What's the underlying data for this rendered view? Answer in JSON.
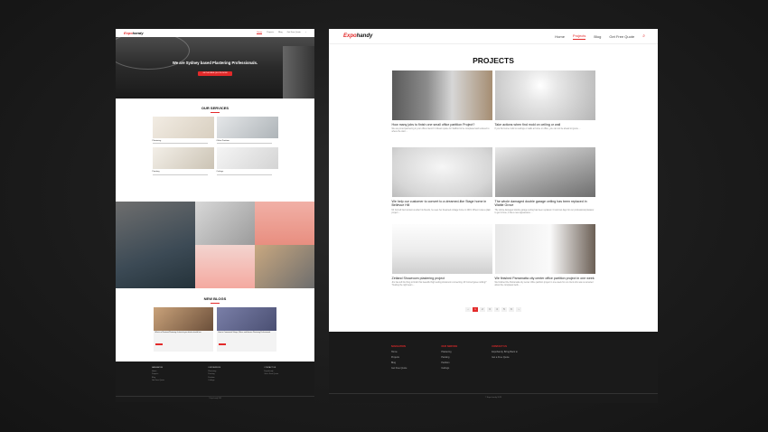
{
  "left": {
    "logo": {
      "mark": "Expo",
      "text": "handy"
    },
    "nav": [
      "Home",
      "Projects",
      "Blog",
      "Get Free Quote"
    ],
    "hero": {
      "title": "We are Sydney based Plastering Professionals.",
      "button": "GET A FREE QUOTE NOW"
    },
    "services": {
      "title": "OUR SERVICES",
      "items": [
        {
          "name": "Plastering"
        },
        {
          "name": "Office Partition"
        },
        {
          "name": "Painting"
        },
        {
          "name": "Ceilings"
        }
      ]
    },
    "blogs": {
      "title": "NEW BLOGS",
      "items": [
        {
          "caption": "What is a Plasterer/Plastering & what do you do/who should hire"
        },
        {
          "caption": "How to Commercial Shops, Offices and Houses Plastering Professionals"
        }
      ]
    },
    "footer": {
      "cols": [
        {
          "head": "NAVIGATION",
          "items": [
            "Home",
            "Projects",
            "Blog",
            "Get Free Quote"
          ]
        },
        {
          "head": "OUR SERVICE",
          "items": [
            "Plastering",
            "Painting",
            "Partition",
            "Ceilings"
          ]
        },
        {
          "head": "CONTACT US",
          "items": [
            "Expohandy",
            "Get a Free Quote"
          ]
        }
      ],
      "copy": "© Expo handy 2023"
    }
  },
  "right": {
    "logo": {
      "mark": "Expo",
      "text": "handy"
    },
    "nav": [
      "Home",
      "Projects",
      "Blog",
      "Get Free Quote"
    ],
    "nav_active": "Projects",
    "title": "PROJECTS",
    "cards": [
      {
        "title": "How many jobs to finish one small office partition Project?",
        "excerpt": "We are proud partnering in your office interior! A Dream space for Stafford to be completed and reduced to where the start ..."
      },
      {
        "title": "Take actions when find mold on ceiling or wall",
        "excerpt": "If you find some mold on ceilings or walls at home or office, you can not be ahead to ignore ..."
      },
      {
        "title": "We help our customer to convert to a dreamed-like Stage home in Bellevue Hill",
        "excerpt": "Mr Cornell had contact us after his friends, he sees her dreamed cottage home in 2019. When it was a plain project ..."
      },
      {
        "title": "The whole damaged double garage ceiling has been replaced in Wattle Grove",
        "excerpt": "The whole damaged double garage ceiling has been replaced. It took two days for our professional plasterer to get it done, it has a new appearance ..."
      },
      {
        "title": "Zetland Showroom plastering project",
        "excerpt": "Jim has left his thing to finish this beautiful high ceiling showroom connecting. Mr Cornell gave nothing? Trusting the right team ..."
      },
      {
        "title": "We finished Parramatta city center office partition project in one week",
        "excerpt": "We finished the Parramatta city center office partition project in one week for our client who was so amazed about the completed work ..."
      }
    ],
    "pagination": [
      "‹",
      "1",
      "2",
      "3",
      "4",
      "5",
      "6",
      "›"
    ],
    "pagination_active": "1",
    "footer": {
      "cols": [
        {
          "head": "NAVIGATION",
          "items": [
            "Home",
            "Projects",
            "Blog",
            "Get Free Quote"
          ]
        },
        {
          "head": "OUR SERVICE",
          "items": [
            "Plastering",
            "Painting",
            "Partition",
            "Ceilings"
          ]
        },
        {
          "head": "CONTACT US",
          "items": [
            "Expohandy, Bring Back to",
            "Get a Free Quote"
          ]
        }
      ],
      "copy": "© Expo handy 2023"
    }
  }
}
